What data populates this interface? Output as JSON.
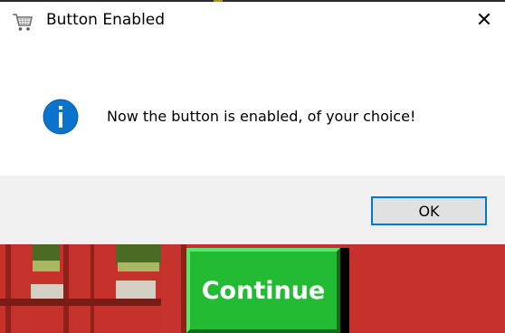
{
  "dialog": {
    "title": "Button Enabled",
    "close_glyph": "✕",
    "message": "Now the button is enabled, of your choice!",
    "ok_label": "OK",
    "icons": {
      "app": "shopping-cart-icon",
      "message": "info-icon"
    },
    "colors": {
      "info_blue": "#0a73cc",
      "ok_border": "#0078d7",
      "footer": "#f0f0f0"
    }
  },
  "background": {
    "continue_label": "Continue",
    "colors": {
      "button_green": "#22bb33",
      "scene_red": "#c6322b"
    }
  }
}
